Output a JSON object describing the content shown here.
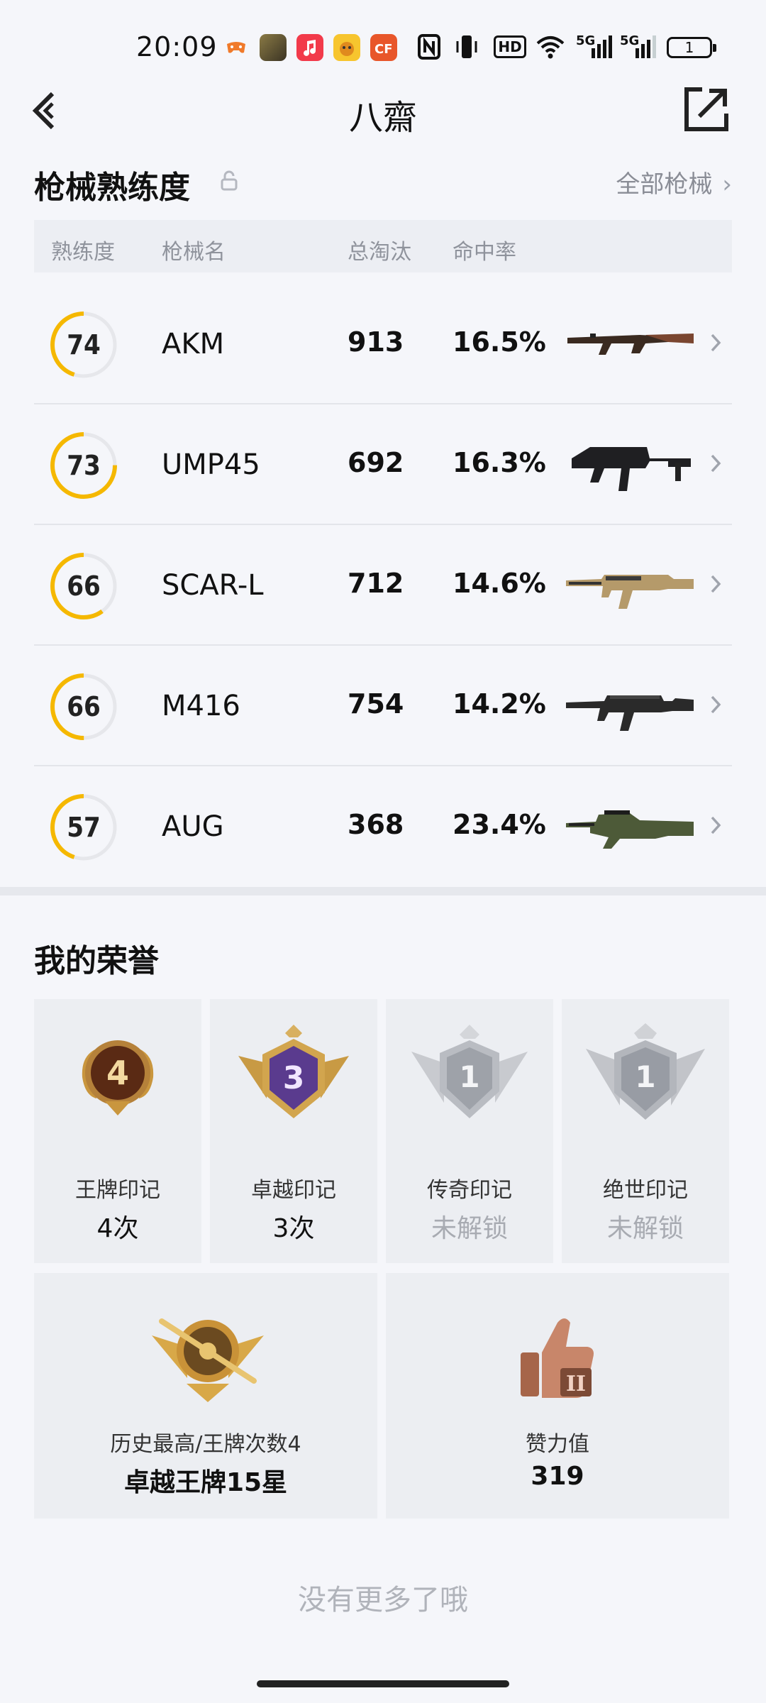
{
  "status_bar": {
    "time": "20:09",
    "icons": [
      "game-controller-icon",
      "pubg-app-icon",
      "music-app-icon",
      "kids-app-icon",
      "crossfire-app-icon",
      "nfc-icon",
      "vibrate-icon",
      "hd-icon",
      "wifi-icon",
      "signal-5g-icon",
      "signal-5g-icon"
    ],
    "hd_text": "HD",
    "sig1": "5G",
    "sig2": "5G",
    "battery": "1"
  },
  "header": {
    "title": "八齋"
  },
  "guns": {
    "title": "枪械熟练度",
    "all_link": "全部枪械",
    "headers": {
      "mastery": "熟练度",
      "name": "枪械名",
      "kills": "总淘汰",
      "accuracy": "命中率"
    },
    "accent": "#f5b800",
    "rows": [
      {
        "mastery": "74",
        "mastery_level": 0.45,
        "name": "AKM",
        "kills": "913",
        "accuracy": "16.5%",
        "gun": "akm"
      },
      {
        "mastery": "73",
        "mastery_level": 0.75,
        "name": "UMP45",
        "kills": "692",
        "accuracy": "16.3%",
        "gun": "ump45"
      },
      {
        "mastery": "66",
        "mastery_level": 0.6,
        "name": "SCAR-L",
        "kills": "712",
        "accuracy": "14.6%",
        "gun": "scarl"
      },
      {
        "mastery": "66",
        "mastery_level": 0.5,
        "name": "M416",
        "kills": "754",
        "accuracy": "14.2%",
        "gun": "m416"
      },
      {
        "mastery": "57",
        "mastery_level": 0.45,
        "name": "AUG",
        "kills": "368",
        "accuracy": "23.4%",
        "gun": "aug"
      }
    ]
  },
  "honors": {
    "title": "我的荣誉",
    "cards": [
      {
        "badge_number": "4",
        "label": "王牌印记",
        "value": "4次"
      },
      {
        "badge_number": "3",
        "label": "卓越印记",
        "value": "3次"
      },
      {
        "badge_number": "1",
        "label": "传奇印记",
        "value": "未解锁"
      },
      {
        "badge_number": "1",
        "label": "绝世印记",
        "value": "未解锁"
      }
    ],
    "highest": {
      "label": "历史最高/王牌次数4",
      "value": "卓越王牌15星"
    },
    "likes": {
      "label": "赞力值",
      "value": "319"
    }
  },
  "footer": {
    "no_more": "没有更多了哦"
  }
}
